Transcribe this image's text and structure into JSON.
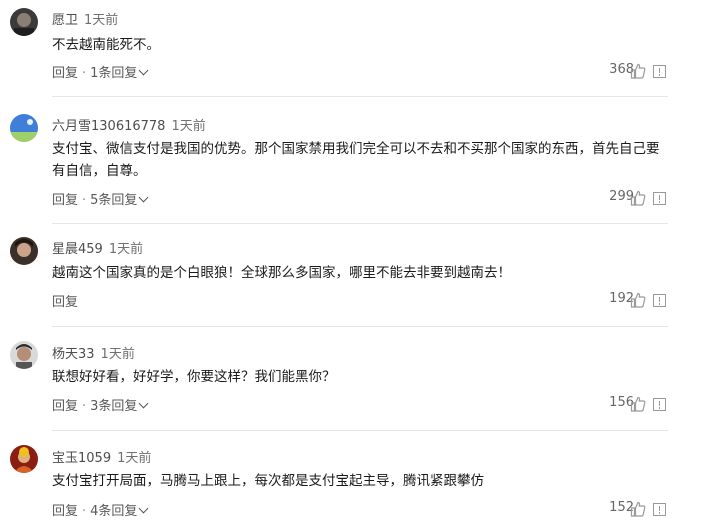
{
  "comments": [
    {
      "username": "愿卫",
      "time": "1天前",
      "text": "不去越南能死不。",
      "reply_label": "回复",
      "reply_count": "1条回复",
      "likes": "368",
      "avatar": "avatar-dark-portrait"
    },
    {
      "username": "六月雪130616778",
      "time": "1天前",
      "text": "支付宝、微信支付是我国的优势。那个国家禁用我们完全可以不去和不买那个国家的东西，首先自己要有自信，自尊。",
      "reply_label": "回复",
      "reply_count": "5条回复",
      "likes": "299",
      "avatar": "avatar-blue-sky"
    },
    {
      "username": "星晨459",
      "time": "1天前",
      "text": "越南这个国家真的是个白眼狼！全球那么多国家，哪里不能去非要到越南去！",
      "reply_label": "回复",
      "reply_count": "",
      "likes": "192",
      "avatar": "avatar-girl-portrait"
    },
    {
      "username": "杨天33",
      "time": "1天前",
      "text": "联想好好看，好好学，你要这样？我们能黑你？",
      "reply_label": "回复",
      "reply_count": "3条回复",
      "likes": "156",
      "avatar": "avatar-man-portrait"
    },
    {
      "username": "宝玉1059",
      "time": "1天前",
      "text": "支付宝打开局面，马腾马上跟上，每次都是支付宝起主导，腾讯紧跟攀仿",
      "reply_label": "回复",
      "reply_count": "4条回复",
      "likes": "152",
      "avatar": "avatar-red-figure"
    }
  ],
  "icons": {
    "like": "thumb-up-icon",
    "report": "report-icon",
    "expand": "chevron-down-icon"
  },
  "colors": {
    "text": "#1a1a1a",
    "meta": "#4d4d4d",
    "divider": "#e6e6e6"
  }
}
